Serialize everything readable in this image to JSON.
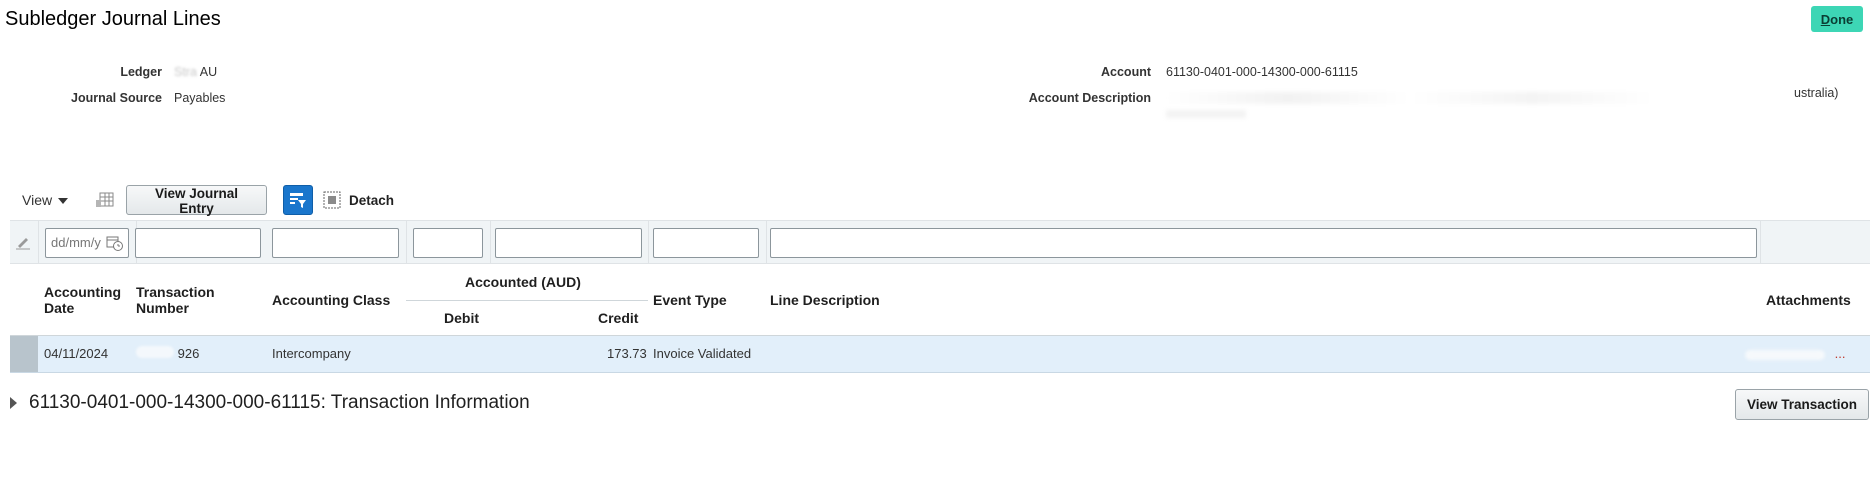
{
  "header": {
    "title": "Subledger Journal Lines",
    "done_prefix": "D",
    "done_rest": "one"
  },
  "info": {
    "ledger_label": "Ledger",
    "ledger_value_redacted": "Stra   ",
    "ledger_value_suffix": "AU",
    "journal_source_label": "Journal Source",
    "journal_source_value": "Payables",
    "account_label": "Account",
    "account_value": "61130-0401-000-14300-000-61115",
    "account_description_label": "Account Description",
    "account_description_value": "ustralia)"
  },
  "toolbar": {
    "view_label": "View",
    "view_journal_entry_label": "View Journal Entry",
    "detach_label": "Detach"
  },
  "filters": {
    "date_placeholder": "dd/mm/y"
  },
  "table": {
    "columns": {
      "accounting_date": "Accounting Date",
      "accounting_date_l1": "Accounting",
      "accounting_date_l2": "Date",
      "transaction_number_l1": "Transaction",
      "transaction_number_l2": "Number",
      "accounting_class": "Accounting Class",
      "accounted_group": "Accounted (AUD)",
      "debit": "Debit",
      "credit": "Credit",
      "event_type": "Event Type",
      "line_description": "Line Description",
      "attachments": "Attachments"
    },
    "rows": [
      {
        "accounting_date": "04/11/2024",
        "transaction_number": "926",
        "accounting_class": "Intercompany",
        "debit": "",
        "credit": "173.73",
        "event_type": "Invoice Validated",
        "line_description": "",
        "attachments": "..."
      }
    ]
  },
  "section": {
    "title": "61130-0401-000-14300-000-61115: Transaction Information",
    "view_transaction_label": "View Transaction"
  },
  "colors": {
    "done_bg": "#3dd6b5",
    "filter_btn_bg": "#1a76cc",
    "row_selected_bg": "#e2effa"
  }
}
